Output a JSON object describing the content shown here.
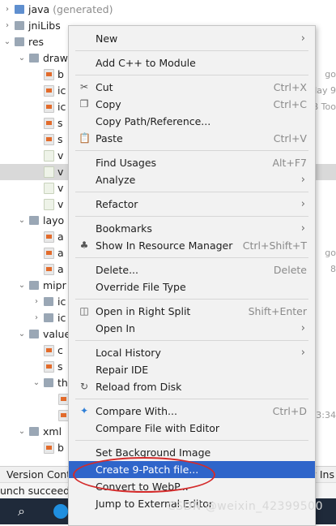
{
  "tree": {
    "rows": [
      {
        "label": "java",
        "suffix": " (generated)",
        "indent": 0,
        "icon": "folder-blue",
        "arrow": "›",
        "note": ""
      },
      {
        "label": "jniLibs",
        "suffix": "",
        "indent": 0,
        "icon": "folder",
        "arrow": "›",
        "note": ""
      },
      {
        "label": "res",
        "suffix": "",
        "indent": 0,
        "icon": "folder",
        "arrow": "⌄",
        "note": ""
      },
      {
        "label": "draw",
        "suffix": "",
        "indent": 1,
        "icon": "folder",
        "arrow": "⌄",
        "note": ""
      },
      {
        "label": "b",
        "suffix": "",
        "indent": 2,
        "icon": "xml",
        "arrow": "",
        "note": "go"
      },
      {
        "label": "ic",
        "suffix": "",
        "indent": 2,
        "icon": "xml",
        "arrow": "",
        "note": "day 9"
      },
      {
        "label": "ic",
        "suffix": "",
        "indent": 2,
        "icon": "xml",
        "arrow": "",
        "note": "B Too"
      },
      {
        "label": "s",
        "suffix": "",
        "indent": 2,
        "icon": "xml",
        "arrow": "",
        "note": ""
      },
      {
        "label": "s",
        "suffix": "",
        "indent": 2,
        "icon": "xml",
        "arrow": "",
        "note": ""
      },
      {
        "label": "v",
        "suffix": "",
        "indent": 2,
        "icon": "res",
        "arrow": "",
        "note": ""
      },
      {
        "label": "v",
        "suffix": "",
        "indent": 2,
        "icon": "res",
        "arrow": "",
        "note": "",
        "selected": true
      },
      {
        "label": "v",
        "suffix": "",
        "indent": 2,
        "icon": "res",
        "arrow": "",
        "note": ""
      },
      {
        "label": "v",
        "suffix": "",
        "indent": 2,
        "icon": "res",
        "arrow": "",
        "note": ""
      },
      {
        "label": "layo",
        "suffix": "",
        "indent": 1,
        "icon": "folder",
        "arrow": "⌄",
        "note": ""
      },
      {
        "label": "a",
        "suffix": "",
        "indent": 2,
        "icon": "xml",
        "arrow": "",
        "note": ""
      },
      {
        "label": "a",
        "suffix": "",
        "indent": 2,
        "icon": "xml",
        "arrow": "",
        "note": "go"
      },
      {
        "label": "a",
        "suffix": "",
        "indent": 2,
        "icon": "xml",
        "arrow": "",
        "note": "8"
      },
      {
        "label": "mipr",
        "suffix": "",
        "indent": 1,
        "icon": "folder",
        "arrow": "⌄",
        "note": ""
      },
      {
        "label": "ic",
        "suffix": "",
        "indent": 2,
        "icon": "folder",
        "arrow": "›",
        "note": ""
      },
      {
        "label": "ic",
        "suffix": "",
        "indent": 2,
        "icon": "folder",
        "arrow": "›",
        "note": ""
      },
      {
        "label": "value",
        "suffix": "",
        "indent": 1,
        "icon": "folder",
        "arrow": "⌄",
        "note": ""
      },
      {
        "label": "c",
        "suffix": "",
        "indent": 2,
        "icon": "xml",
        "arrow": "",
        "note": ""
      },
      {
        "label": "s",
        "suffix": "",
        "indent": 2,
        "icon": "xml",
        "arrow": "",
        "note": ""
      },
      {
        "label": "th",
        "suffix": "",
        "indent": 2,
        "icon": "folder",
        "arrow": "⌄",
        "note": ""
      },
      {
        "label": "",
        "suffix": "",
        "indent": 3,
        "icon": "xml",
        "arrow": "",
        "note": ""
      },
      {
        "label": "",
        "suffix": "",
        "indent": 3,
        "icon": "xml",
        "arrow": "",
        "note": "3:34"
      },
      {
        "label": "xml",
        "suffix": "",
        "indent": 1,
        "icon": "folder",
        "arrow": "⌄",
        "note": ""
      },
      {
        "label": "b",
        "suffix": "",
        "indent": 2,
        "icon": "xml",
        "arrow": "",
        "note": ""
      }
    ]
  },
  "menu": {
    "items": [
      {
        "label": "New",
        "shortcut": "",
        "submenu": true,
        "icon": "",
        "sep_before": false
      },
      {
        "label": "Add C++ to Module",
        "shortcut": "",
        "submenu": false,
        "icon": "",
        "sep_before": true
      },
      {
        "label": "Cut",
        "shortcut": "Ctrl+X",
        "submenu": false,
        "icon": "✂",
        "sep_before": true
      },
      {
        "label": "Copy",
        "shortcut": "Ctrl+C",
        "submenu": false,
        "icon": "❐",
        "sep_before": false
      },
      {
        "label": "Copy Path/Reference...",
        "shortcut": "",
        "submenu": false,
        "icon": "",
        "sep_before": false
      },
      {
        "label": "Paste",
        "shortcut": "Ctrl+V",
        "submenu": false,
        "icon": "📋",
        "sep_before": false
      },
      {
        "label": "Find Usages",
        "shortcut": "Alt+F7",
        "submenu": false,
        "icon": "",
        "sep_before": true
      },
      {
        "label": "Analyze",
        "shortcut": "",
        "submenu": true,
        "icon": "",
        "sep_before": false
      },
      {
        "label": "Refactor",
        "shortcut": "",
        "submenu": true,
        "icon": "",
        "sep_before": true
      },
      {
        "label": "Bookmarks",
        "shortcut": "",
        "submenu": true,
        "icon": "",
        "sep_before": true
      },
      {
        "label": "Show In Resource Manager",
        "shortcut": "Ctrl+Shift+T",
        "submenu": false,
        "icon": "♣",
        "sep_before": false
      },
      {
        "label": "Delete...",
        "shortcut": "Delete",
        "submenu": false,
        "icon": "",
        "sep_before": true
      },
      {
        "label": "Override File Type",
        "shortcut": "",
        "submenu": false,
        "icon": "",
        "sep_before": false
      },
      {
        "label": "Open in Right Split",
        "shortcut": "Shift+Enter",
        "submenu": false,
        "icon": "◫",
        "sep_before": true
      },
      {
        "label": "Open In",
        "shortcut": "",
        "submenu": true,
        "icon": "",
        "sep_before": false
      },
      {
        "label": "Local History",
        "shortcut": "",
        "submenu": true,
        "icon": "",
        "sep_before": true
      },
      {
        "label": "Repair IDE",
        "shortcut": "",
        "submenu": false,
        "icon": "",
        "sep_before": false
      },
      {
        "label": "Reload from Disk",
        "shortcut": "",
        "submenu": false,
        "icon": "↻",
        "sep_before": false
      },
      {
        "label": "Compare With...",
        "shortcut": "Ctrl+D",
        "submenu": false,
        "icon": "✦",
        "sep_before": true
      },
      {
        "label": "Compare File with Editor",
        "shortcut": "",
        "submenu": false,
        "icon": "",
        "sep_before": false
      },
      {
        "label": "Set Background Image",
        "shortcut": "",
        "submenu": false,
        "icon": "",
        "sep_before": true
      },
      {
        "label": "Create 9-Patch file...",
        "shortcut": "",
        "submenu": false,
        "icon": "",
        "sep_before": false,
        "highlighted": true
      },
      {
        "label": "Convert to WebP...",
        "shortcut": "",
        "submenu": false,
        "icon": "",
        "sep_before": false
      },
      {
        "label": "Jump to External Editor",
        "shortcut": "",
        "submenu": false,
        "icon": "",
        "sep_before": false
      }
    ]
  },
  "bottom": {
    "toolbar_left": "Version Contro",
    "toolbar_right": "ty Ins",
    "status_left": "unch succeede",
    "watermark": "CSDN @weixin_42399500"
  },
  "colors": {
    "highlight": "#2f65ca",
    "annotation_ring": "#d42b2b",
    "taskbar": "#1f2a3a"
  }
}
